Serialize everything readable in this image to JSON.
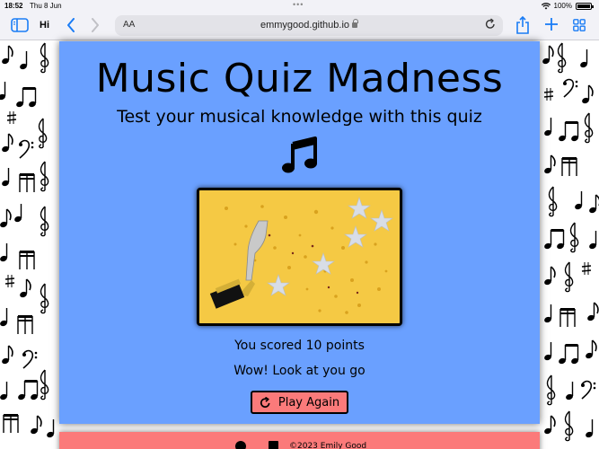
{
  "status_bar": {
    "time": "18:52",
    "date": "Thu 8 Jun",
    "battery": "100%"
  },
  "browser": {
    "tab_label": "Hi",
    "text_size_label": "AA",
    "url": "emmygood.github.io"
  },
  "quiz": {
    "title": "Music Quiz Madness",
    "subtitle": "Test your musical knowledge with this quiz",
    "score_text": "You scored 10 points",
    "message": "Wow! Look at you go",
    "play_again_label": "Play Again"
  },
  "footer": {
    "copyright": "©2023 Emily Good"
  },
  "icons": {
    "music": "music-note-icon",
    "github": "github-icon",
    "linkedin": "linkedin-icon",
    "replay": "redo-icon"
  },
  "colors": {
    "card_background": "#6aa0ff",
    "button_background": "#fb7a7a",
    "footer_background": "#fb7a7a",
    "browser_accent": "#1a7cf5"
  }
}
